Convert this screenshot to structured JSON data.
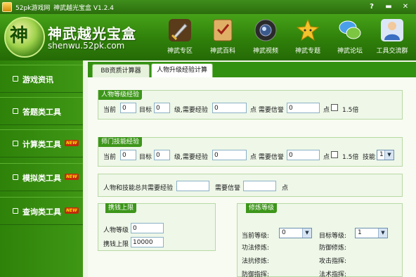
{
  "window": {
    "site": "52pk游戏网",
    "name": "神武越光宝盒 V1.2.4",
    "help_icon": "help-icon",
    "min_icon": "minimize-icon",
    "close_icon": "close-icon"
  },
  "header": {
    "logo_char": "神",
    "title": "神武越光宝盒",
    "url": "shenwu.52pk.com",
    "nav": [
      {
        "label": "神武专区",
        "icon": "sword-icon",
        "color": "#8b5e2b"
      },
      {
        "label": "神武百科",
        "icon": "checklist-icon",
        "color": "#c98a2c"
      },
      {
        "label": "神武视频",
        "icon": "camera-icon",
        "color": "#333333"
      },
      {
        "label": "神武专题",
        "icon": "star-icon",
        "color": "#e7b21a"
      },
      {
        "label": "神武论坛",
        "icon": "chat-icon",
        "color": "#3a7fd0"
      },
      {
        "label": "工具交流群",
        "icon": "people-icon",
        "color": "#4b6fb2"
      }
    ]
  },
  "sidebar": {
    "items": [
      {
        "label": "游戏资讯",
        "new": false
      },
      {
        "label": "答题类工具",
        "new": false
      },
      {
        "label": "计算类工具",
        "new": true
      },
      {
        "label": "模拟类工具",
        "new": true
      },
      {
        "label": "查询类工具",
        "new": true
      }
    ],
    "new_label": "NEW"
  },
  "tabs": {
    "tab1": "BB资质计算器",
    "tab2": "人物升级经验计算"
  },
  "section_char": {
    "title": "人物等级经验",
    "current_label": "当前",
    "current_value": "0",
    "target_label": "目标",
    "target_value": "0",
    "need_exp_label": "级,需要经验",
    "need_exp_value": "0",
    "need_credit_label": "点 需要信誉",
    "need_credit_value": "0",
    "point_label": "点",
    "multiplier_label": "1.5倍"
  },
  "section_skill": {
    "title": "师门技能经验",
    "current_label": "当前",
    "current_value": "0",
    "target_label": "目标",
    "target_value": "0",
    "need_exp_label": "级,需要经验",
    "need_exp_value": "0",
    "need_credit_label": "点 需要信誉",
    "need_credit_value": "0",
    "point_label": "点",
    "multiplier_label": "1.5倍",
    "skill_label": "技能",
    "skill_value": "1"
  },
  "section_total": {
    "total_label": "人物和技能总共需要经验",
    "total_value": "",
    "credit_label": "需要信誉",
    "credit_value": "",
    "point_label": "点"
  },
  "section_money": {
    "title": "携钱上限",
    "level_label": "人物等级",
    "level_value": "0",
    "limit_label": "携钱上限",
    "limit_value": "10000"
  },
  "section_cultivation": {
    "title": "修炼等级",
    "current_label": "当前等级:",
    "current_value": "0",
    "target_label": "目标等级:",
    "target_value": "1",
    "rows": [
      {
        "left": "功法修炼:",
        "right": "防御修炼:"
      },
      {
        "left": "法抗修炼:",
        "right": "攻击指挥:"
      },
      {
        "left": "防御指挥:",
        "right": "法术指挥:"
      }
    ]
  }
}
